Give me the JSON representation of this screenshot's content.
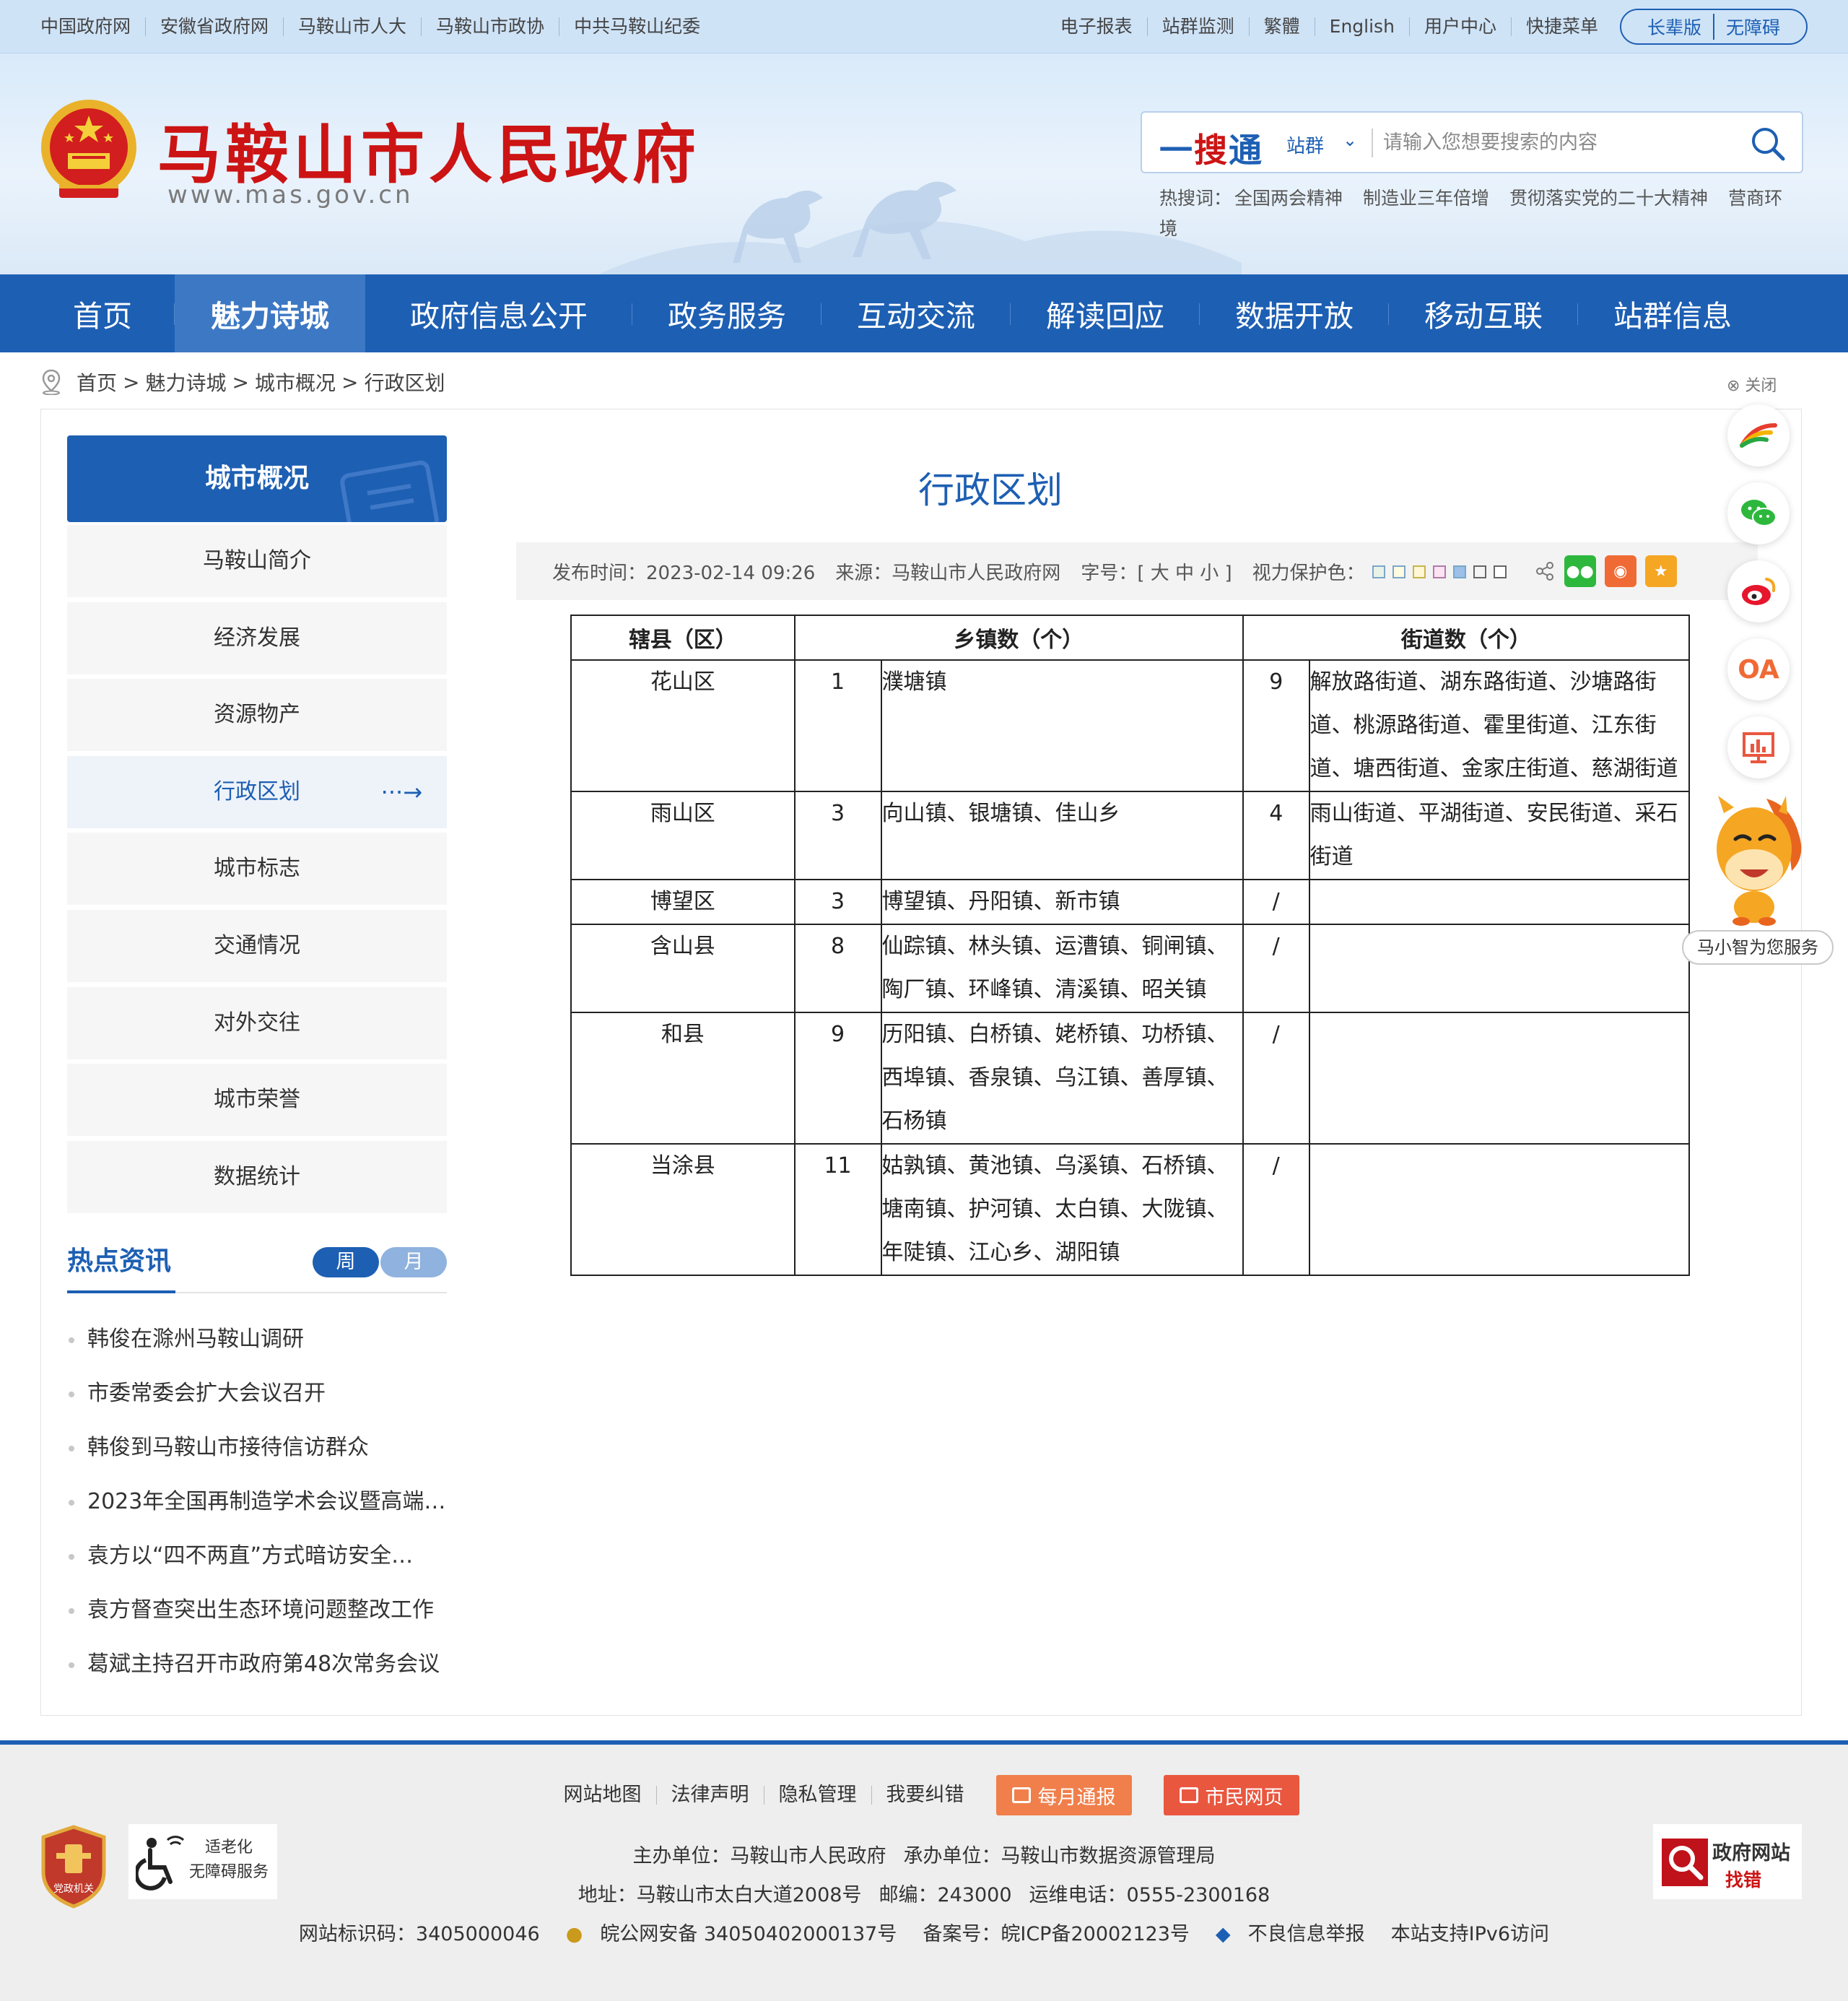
{
  "topbar": {
    "left_links": [
      "中国政府网",
      "安徽省政府网",
      "马鞍山市人大",
      "马鞍山市政协",
      "中共马鞍山纪委"
    ],
    "right_links": [
      "电子报表",
      "站群监测",
      "繁體",
      "English",
      "用户中心",
      "快捷菜单"
    ],
    "elder_version": "长辈版",
    "accessibility": "无障碍"
  },
  "header": {
    "site_title": "马鞍山市人民政府",
    "site_url": "www.mas.gov.cn",
    "search": {
      "brand_a": "一",
      "brand_b": "搜",
      "brand_c": "通",
      "scope": "站群",
      "placeholder": "请输入您想要搜索的内容"
    },
    "hotwords_label": "热搜词：",
    "hotwords": [
      "全国两会精神",
      "制造业三年倍增",
      "贯彻落实党的二十大精神",
      "营商环境"
    ]
  },
  "nav": {
    "items": [
      "首页",
      "魅力诗城",
      "政府信息公开",
      "政务服务",
      "互动交流",
      "解读回应",
      "数据开放",
      "移动互联",
      "站群信息"
    ],
    "active_index": 1
  },
  "breadcrumb": [
    "首页",
    "魅力诗城",
    "城市概况",
    "行政区划"
  ],
  "sidebar": {
    "title": "城市概况",
    "items": [
      "马鞍山简介",
      "经济发展",
      "资源物产",
      "行政区划",
      "城市标志",
      "交通情况",
      "对外交往",
      "城市荣誉",
      "数据统计"
    ],
    "active_index": 3,
    "active_arrow": "···→"
  },
  "hot_news": {
    "title": "热点资讯",
    "tab_week": "周",
    "tab_month": "月",
    "items": [
      "韩俊在滁州马鞍山调研",
      "市委常委会扩大会议召开",
      "韩俊到马鞍山市接待信访群众",
      "2023年全国再制造学术会议暨高端…",
      "袁方以“四不两直”方式暗访安全…",
      "袁方督查突出生态环境问题整改工作",
      "葛斌主持召开市政府第48次常务会议"
    ]
  },
  "article": {
    "title": "行政区划",
    "publish_time": "发布时间：2023-02-14 09:26",
    "source": "来源：马鞍山市人民政府网",
    "font_size": "字号：[ 大 中 小 ]",
    "eye_care": "视力保护色：",
    "eye_care_colors": [
      "#e8f2e8",
      "#fffbe0",
      "#fff7d6",
      "#fbe3f3",
      "#dde9f7",
      "#f4f4f4",
      "#ffffff"
    ],
    "table": {
      "headers": [
        "辖县（区）",
        "乡镇数（个）",
        "街道数（个）"
      ],
      "rows": [
        {
          "district": "花山区",
          "town_count": "1",
          "towns": "濮塘镇",
          "street_count": "9",
          "streets": "解放路街道、湖东路街道、沙塘路街道、桃源路街道、霍里街道、江东街道、塘西街道、金家庄街道、慈湖街道"
        },
        {
          "district": "雨山区",
          "town_count": "3",
          "towns": "向山镇、银塘镇、佳山乡",
          "street_count": "4",
          "streets": "雨山街道、平湖街道、安民街道、采石街道"
        },
        {
          "district": "博望区",
          "town_count": "3",
          "towns": "博望镇、丹阳镇、新市镇",
          "street_count": "/",
          "streets": ""
        },
        {
          "district": "含山县",
          "town_count": "8",
          "towns": "仙踪镇、林头镇、运漕镇、铜闸镇、陶厂镇、环峰镇、清溪镇、昭关镇",
          "street_count": "/",
          "streets": ""
        },
        {
          "district": "和县",
          "town_count": "9",
          "towns": "历阳镇、白桥镇、姥桥镇、功桥镇、西埠镇、香泉镇、乌江镇、善厚镇、石杨镇",
          "street_count": "/",
          "streets": ""
        },
        {
          "district": "当涂县",
          "town_count": "11",
          "towns": "姑孰镇、黄池镇、乌溪镇、石桥镇、塘南镇、护河镇、太白镇、大陇镇、年陡镇、江心乡、湖阳镇",
          "street_count": "/",
          "streets": ""
        }
      ]
    }
  },
  "float_bar": {
    "close_label": "⊗ 关闭",
    "oa_label": "OA",
    "mascot_label": "马小智为您服务"
  },
  "footer": {
    "links": [
      "网站地图",
      "法律声明",
      "隐私管理",
      "我要纠错"
    ],
    "monthly_report": "每月通报",
    "citizen_page": "市民网页",
    "line1": [
      "主办单位：马鞍山市人民政府",
      "承办单位：马鞍山市数据资源管理局"
    ],
    "line2": [
      "地址：马鞍山市太白大道2008号",
      "邮编：243000",
      "运维电话：0555-2300168"
    ],
    "line3": [
      "网站标识码：3405000046",
      "皖公网安备 34050402000137号",
      "备案号：皖ICP备20002123号",
      "不良信息举报",
      "本站支持IPv6访问"
    ],
    "badge_party": "党政机关",
    "aging_badge": [
      "适老化",
      "无障碍服务"
    ],
    "gov_badge": [
      "政府网站",
      "找错"
    ]
  }
}
